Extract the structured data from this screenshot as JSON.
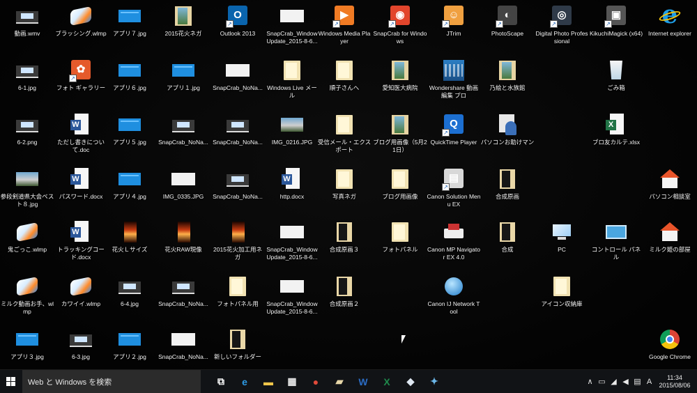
{
  "desktop": {
    "icons": [
      {
        "label": "動画.wmv",
        "icon": "thumb-dark",
        "col": 0,
        "row": 0
      },
      {
        "label": "ブラッシング.wlmp",
        "icon": "wlmp",
        "col": 1,
        "row": 0
      },
      {
        "label": "アプリ７.jpg",
        "icon": "thumb-blue",
        "col": 2,
        "row": 0
      },
      {
        "label": "2015花火ネガ",
        "icon": "folder-img",
        "col": 3,
        "row": 0
      },
      {
        "label": "Outlook 2013",
        "icon": "app-box",
        "color": "#0a64ad",
        "glyph": "O",
        "col": 4,
        "row": 0
      },
      {
        "label": "SnapCrab_Window Update_2015-8-6...",
        "icon": "thumb-white",
        "col": 5,
        "row": 0
      },
      {
        "label": "Windows Media Player",
        "icon": "app-box",
        "color": "#f07b24",
        "glyph": "▶",
        "col": 6,
        "row": 0
      },
      {
        "label": "SnapCrab for Windows",
        "icon": "app-box",
        "color": "#e2452c",
        "glyph": "◉",
        "col": 7,
        "row": 0
      },
      {
        "label": "JTrim",
        "icon": "app-box",
        "color": "#f0a040",
        "glyph": "☺",
        "col": 8,
        "row": 0
      },
      {
        "label": "PhotoScape",
        "icon": "app-box",
        "color": "#444444",
        "glyph": "◐",
        "col": 9,
        "row": 0
      },
      {
        "label": "Digital Photo Professional",
        "icon": "app-box",
        "color": "#2f3a48",
        "glyph": "◎",
        "col": 10,
        "row": 0
      },
      {
        "label": "KikuchiMagick (x64)",
        "icon": "app-box",
        "color": "#555555",
        "glyph": "▣",
        "col": 11,
        "row": 0
      },
      {
        "label": "Internet explorer",
        "icon": "ie",
        "col": 12,
        "row": 0
      },
      {
        "label": "6-1.jpg",
        "icon": "thumb-dark",
        "col": 0,
        "row": 1
      },
      {
        "label": "フォト ギャラリー",
        "icon": "app-box",
        "color": "#e55a2b",
        "glyph": "✿",
        "col": 1,
        "row": 1
      },
      {
        "label": "アプリ６.jpg",
        "icon": "thumb-blue",
        "col": 2,
        "row": 1
      },
      {
        "label": "アプリ１.jpg",
        "icon": "thumb-blue",
        "col": 3,
        "row": 1
      },
      {
        "label": "SnapCrab_NoNa...",
        "icon": "thumb-white",
        "col": 4,
        "row": 1
      },
      {
        "label": "Windows Live メール",
        "icon": "folder",
        "col": 5,
        "row": 1
      },
      {
        "label": "順子さんへ",
        "icon": "folder",
        "col": 6,
        "row": 1
      },
      {
        "label": "愛知医大病院",
        "icon": "folder-img",
        "col": 7,
        "row": 1
      },
      {
        "label": "Wondershare 動画編集 プロ",
        "icon": "video",
        "col": 8,
        "row": 1
      },
      {
        "label": "乃絵と水族館",
        "icon": "folder-img",
        "col": 9,
        "row": 1
      },
      {
        "label": "ごみ箱",
        "icon": "recycle",
        "col": 11,
        "row": 1
      },
      {
        "label": "6-2.png",
        "icon": "thumb-dark",
        "col": 0,
        "row": 2
      },
      {
        "label": "ただし書きについて.doc",
        "icon": "file-doc",
        "col": 1,
        "row": 2
      },
      {
        "label": "アプリ５.jpg",
        "icon": "thumb-blue",
        "col": 2,
        "row": 2
      },
      {
        "label": "SnapCrab_NoNa...",
        "icon": "thumb-dark",
        "col": 3,
        "row": 2
      },
      {
        "label": "SnapCrab_NoNa...",
        "icon": "thumb-dark",
        "col": 4,
        "row": 2
      },
      {
        "label": "IMG_0216.JPG",
        "icon": "thumb-photo",
        "col": 5,
        "row": 2
      },
      {
        "label": "受信メール・エクスポート",
        "icon": "folder",
        "col": 6,
        "row": 2
      },
      {
        "label": "ブログ用画像（5月21日）",
        "icon": "folder-img",
        "col": 7,
        "row": 2
      },
      {
        "label": "QuickTime Player",
        "icon": "app-box",
        "color": "#1c6fd1",
        "glyph": "Q",
        "col": 8,
        "row": 2
      },
      {
        "label": "パソコンお助けマン",
        "icon": "person",
        "col": 9,
        "row": 2
      },
      {
        "label": "ブロ友カルテ.xlsx",
        "icon": "file-xls",
        "col": 11,
        "row": 2
      },
      {
        "label": "参段剣道県大会ベスト８.jpg",
        "icon": "thumb-photo",
        "col": 0,
        "row": 3
      },
      {
        "label": "パスワード.docx",
        "icon": "file-doc",
        "col": 1,
        "row": 3
      },
      {
        "label": "アプリ４.jpg",
        "icon": "thumb-blue",
        "col": 2,
        "row": 3
      },
      {
        "label": "IMG_0335.JPG",
        "icon": "thumb-white",
        "col": 3,
        "row": 3
      },
      {
        "label": "SnapCrab_NoNa...",
        "icon": "thumb-dark",
        "col": 4,
        "row": 3
      },
      {
        "label": "http.docx",
        "icon": "file-doc",
        "col": 5,
        "row": 3
      },
      {
        "label": "写真ネガ",
        "icon": "folder",
        "col": 6,
        "row": 3
      },
      {
        "label": "ブログ用画像",
        "icon": "folder",
        "col": 7,
        "row": 3
      },
      {
        "label": "Canon Solution Menu EX",
        "icon": "app-box",
        "color": "#d8d8d8",
        "glyph": "▤",
        "col": 8,
        "row": 3
      },
      {
        "label": "合成原画",
        "icon": "folder-dark",
        "col": 9,
        "row": 3
      },
      {
        "label": "パソコン相談室",
        "icon": "house",
        "col": 12,
        "row": 3
      },
      {
        "label": "鬼ごっこ.wlmp",
        "icon": "wlmp",
        "col": 0,
        "row": 4
      },
      {
        "label": "トラッキングコード.docx",
        "icon": "file-doc",
        "col": 1,
        "row": 4
      },
      {
        "label": "花火Ｌサイズ",
        "icon": "thumb-fire",
        "col": 2,
        "row": 4
      },
      {
        "label": "花火RAW現像",
        "icon": "thumb-fire",
        "col": 3,
        "row": 4
      },
      {
        "label": "2015花火加工用ネガ",
        "icon": "thumb-fire",
        "col": 4,
        "row": 4
      },
      {
        "label": "SnapCrab_Window Update_2015-8-6...",
        "icon": "thumb-white",
        "col": 5,
        "row": 4
      },
      {
        "label": "合成原画３",
        "icon": "folder-dark",
        "col": 6,
        "row": 4
      },
      {
        "label": "フォトパネル",
        "icon": "folder",
        "col": 7,
        "row": 4
      },
      {
        "label": "Canon MP Navigator EX 4.0",
        "icon": "printer",
        "col": 8,
        "row": 4
      },
      {
        "label": "合成",
        "icon": "folder-dark",
        "col": 9,
        "row": 4
      },
      {
        "label": "PC",
        "icon": "pc",
        "col": 10,
        "row": 4
      },
      {
        "label": "コントロール パネル",
        "icon": "ctrl",
        "col": 11,
        "row": 4
      },
      {
        "label": "ミルク姫の部屋",
        "icon": "house",
        "col": 12,
        "row": 4
      },
      {
        "label": "ミルク動画お手、wlmp",
        "icon": "wlmp",
        "col": 0,
        "row": 5
      },
      {
        "label": "カワイイ.wlmp",
        "icon": "wlmp",
        "col": 1,
        "row": 5
      },
      {
        "label": "6-4.jpg",
        "icon": "thumb-dark",
        "col": 2,
        "row": 5
      },
      {
        "label": "SnapCrab_NoNa...",
        "icon": "thumb-dark",
        "col": 3,
        "row": 5
      },
      {
        "label": "フォトパネル用",
        "icon": "folder",
        "col": 4,
        "row": 5
      },
      {
        "label": "SnapCrab_Window Update_2015-8-6...",
        "icon": "thumb-white",
        "col": 5,
        "row": 5
      },
      {
        "label": "合成原画２",
        "icon": "folder-dark",
        "col": 6,
        "row": 5
      },
      {
        "label": "Canon IJ Network Tool",
        "icon": "globe",
        "col": 8,
        "row": 5
      },
      {
        "label": "アイコン収納庫",
        "icon": "folder",
        "col": 10,
        "row": 5
      },
      {
        "label": "アプリ３.jpg",
        "icon": "thumb-blue",
        "col": 0,
        "row": 6
      },
      {
        "label": "6-3.jpg",
        "icon": "thumb-dark",
        "col": 1,
        "row": 6
      },
      {
        "label": "アプリ２.jpg",
        "icon": "thumb-blue",
        "col": 2,
        "row": 6
      },
      {
        "label": "SnapCrab_NoNa...",
        "icon": "thumb-white",
        "col": 3,
        "row": 6
      },
      {
        "label": "新しいフォルダー",
        "icon": "folder-dark",
        "col": 4,
        "row": 6
      },
      {
        "label": "Google Chrome",
        "icon": "chrome",
        "col": 12,
        "row": 6
      }
    ]
  },
  "taskbar": {
    "search_placeholder": "Web と Windows を検索",
    "pinned": [
      {
        "name": "task-view-icon",
        "glyph": "⧉",
        "color": "#ffffff"
      },
      {
        "name": "edge-icon",
        "glyph": "e",
        "color": "#2d9be6"
      },
      {
        "name": "file-explorer-icon",
        "glyph": "▬",
        "color": "#f0c64a"
      },
      {
        "name": "store-icon",
        "glyph": "▦",
        "color": "#e8e8e8"
      },
      {
        "name": "chrome-taskbar-icon",
        "glyph": "●",
        "color": "#e04a3a"
      },
      {
        "name": "folder-taskbar-icon",
        "glyph": "▰",
        "color": "#e6d6a8"
      },
      {
        "name": "word-taskbar-icon",
        "glyph": "W",
        "color": "#2b6cc4"
      },
      {
        "name": "excel-taskbar-icon",
        "glyph": "X",
        "color": "#1f8a4c"
      },
      {
        "name": "app-taskbar-icon",
        "glyph": "◆",
        "color": "#dfe8f2"
      },
      {
        "name": "pinned-app-icon",
        "glyph": "✦",
        "color": "#6cb7e8"
      }
    ],
    "tray": {
      "chevron": "∧",
      "ime": "A",
      "time": "11:34",
      "date": "2015/08/06"
    }
  }
}
